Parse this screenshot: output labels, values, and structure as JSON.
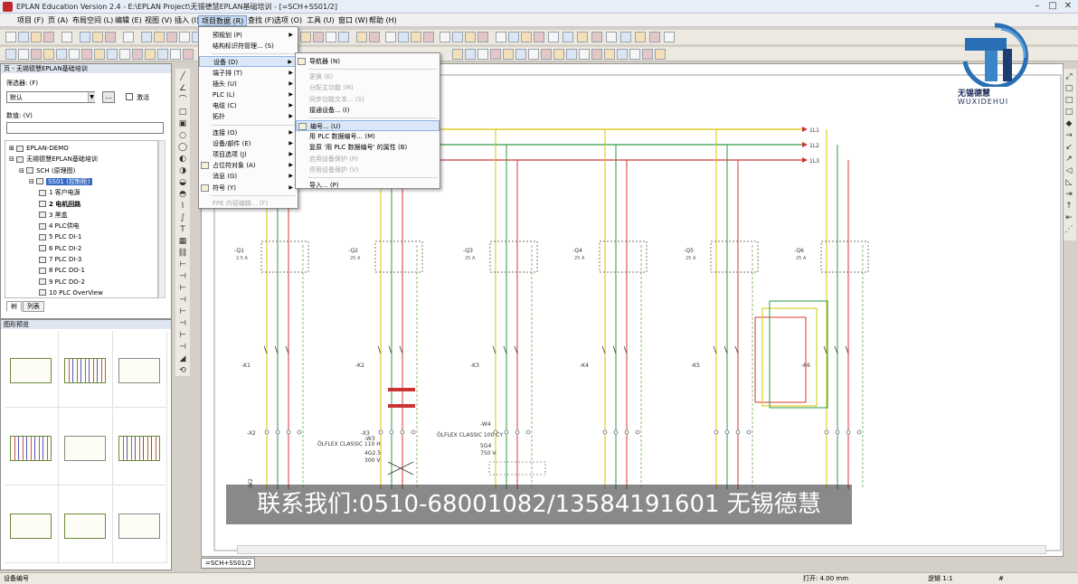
{
  "window": {
    "title": "EPLAN Education Version 2.4 - E:\\EPLAN Project\\无锡德慧EPLAN基础培训 - [=SCH+SS01/2]"
  },
  "menubar": [
    "项目 (F)",
    "页 (A)",
    "布局空间 (L)",
    "编辑 (E)",
    "视图 (V)",
    "插入 (I)",
    "项目数据 (R)",
    "查找 (F)",
    "选项 (O)",
    "工具 (U)",
    "窗口 (W)",
    "帮助 (H)"
  ],
  "page_panel": {
    "title": "页 - 无锡德慧EPLAN基础培训",
    "filter_label": "筛选器: (F)",
    "filter_value": "默认",
    "filter_button": "...",
    "active_label": "激活",
    "value_label": "数值: (V)",
    "tree": [
      {
        "label": "EPLAN-DEMO",
        "level": 0,
        "expander": "⊞"
      },
      {
        "label": "无锡德慧EPLAN基础培训",
        "level": 0,
        "expander": "⊟"
      },
      {
        "label": "SCH (原理图)",
        "level": 1,
        "expander": "⊟"
      },
      {
        "label": "SS01 (控制柜)",
        "level": 2,
        "expander": "⊟",
        "selected": true
      },
      {
        "label": "1 客户电源",
        "level": 3
      },
      {
        "label": "2 电机回路",
        "level": 3,
        "bold": true
      },
      {
        "label": "3 黑盒",
        "level": 3
      },
      {
        "label": "4 PLC供电",
        "level": 3
      },
      {
        "label": "5 PLC DI-1",
        "level": 3
      },
      {
        "label": "6 PLC DI-2",
        "level": 3
      },
      {
        "label": "7 PLC DI-3",
        "level": 3
      },
      {
        "label": "8 PLC DO-1",
        "level": 3
      },
      {
        "label": "9 PLC DO-2",
        "level": 3
      },
      {
        "label": "10 PLC OverView",
        "level": 3
      }
    ],
    "tabs": [
      "树",
      "列表"
    ]
  },
  "preview_panel": {
    "title": "图形预览"
  },
  "project_data_menu": [
    {
      "label": "预规划 (P)",
      "arrow": true
    },
    {
      "label": "结构标识符管理... (S)"
    },
    {
      "sep": true
    },
    {
      "label": "设备 (D)",
      "arrow": true,
      "highlight": true
    },
    {
      "label": "端子排 (T)",
      "arrow": true
    },
    {
      "label": "插头 (U)",
      "arrow": true
    },
    {
      "label": "PLC (L)",
      "arrow": true
    },
    {
      "label": "电缆 (C)",
      "arrow": true
    },
    {
      "label": "拓扑",
      "arrow": true
    },
    {
      "sep": true
    },
    {
      "label": "连接 (O)",
      "arrow": true
    },
    {
      "label": "设备/部件 (E)",
      "arrow": true
    },
    {
      "label": "项目选项 (J)",
      "arrow": true
    },
    {
      "label": "占位符对象 (A)",
      "arrow": true,
      "icon": true
    },
    {
      "label": "消息 (G)",
      "arrow": true
    },
    {
      "label": "符号 (Y)",
      "arrow": true,
      "icon": true
    },
    {
      "sep": true
    },
    {
      "label": "FPE 内容编辑... (F)",
      "disabled": true
    }
  ],
  "device_submenu": [
    {
      "label": "导航器 (N)",
      "icon": true
    },
    {
      "sep": true
    },
    {
      "label": "更换 (E)",
      "disabled": true
    },
    {
      "label": "分配主功能 (M)",
      "disabled": true
    },
    {
      "label": "同步功能文本... (S)",
      "disabled": true
    },
    {
      "label": "接通设备... (I)"
    },
    {
      "sep": true
    },
    {
      "label": "编号... (U)",
      "highlight": true,
      "icon": true
    },
    {
      "label": "用 PLC 数据编号... (M)"
    },
    {
      "label": "复原 '用 PLC 数据编号' 的属性 (B)"
    },
    {
      "label": "启用设备保护 (P)",
      "disabled": true
    },
    {
      "label": "停用设备保护 (V)",
      "disabled": true
    },
    {
      "sep": true
    },
    {
      "label": "导入... (P)"
    }
  ],
  "sheet_tab": "=SCH+SS01/2",
  "status": {
    "left": "设备编号",
    "coord": "打开: 4.00 mm",
    "logic": "逻辑 1:1",
    "hash": "#"
  },
  "watermark": "联系我们:0510-68001082/13584191601 无锡德慧",
  "logo": {
    "name": "无锡德慧",
    "pinyin": "WUXIDEHUI"
  },
  "schematic": {
    "bus_labels": [
      "1L1",
      "1L2",
      "1L3"
    ],
    "breakers": [
      "-Q1",
      "-Q2",
      "-Q3",
      "-Q4",
      "-Q5",
      "-Q6"
    ],
    "contactors": [
      "-K1",
      "-K2",
      "-K3",
      "-K4",
      "-K5",
      "-K6"
    ],
    "cable_labels": [
      "ÖLFLEX CLASSIC 110 H",
      "ÖLFLEX CLASSIC 100 CY"
    ],
    "cable_ids": [
      "-W2",
      "-W3",
      "-W4"
    ],
    "cable_specs": [
      "4G2.5",
      "300 V",
      "5G4",
      "750 V"
    ],
    "terminal_strips": [
      "-X2",
      "-X3"
    ],
    "breaker_ratings": [
      "2.5 A",
      "25 A",
      "25 A",
      "25 A",
      "25 A",
      "25 A"
    ],
    "colors": {
      "l1": "#d7c400",
      "l2": "#2e9b45",
      "l3": "#d43a3a",
      "pe": "#6ab04c"
    }
  }
}
